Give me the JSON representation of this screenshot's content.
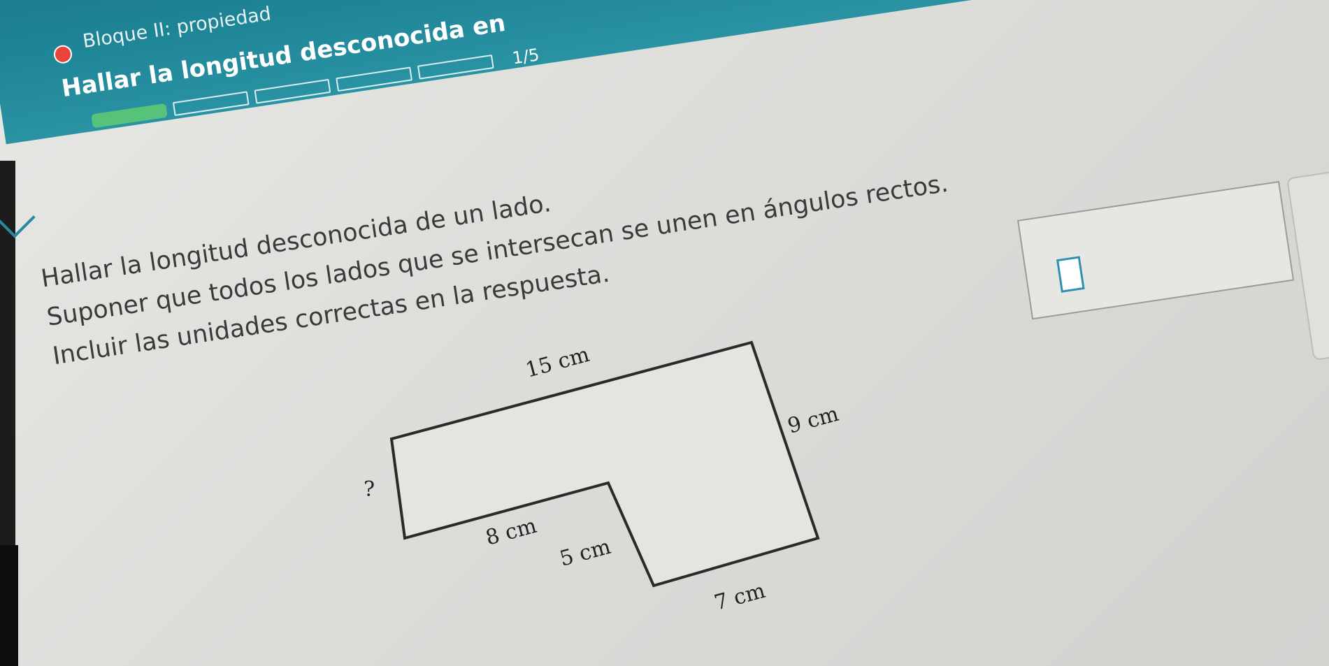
{
  "header": {
    "block_title": "Bloque II: propiedad",
    "topic_title": "Hallar la longitud desconocida en",
    "progress": {
      "current": 1,
      "total": 5,
      "label": "1/5"
    }
  },
  "problem": {
    "line1": "Hallar la longitud desconocida de un lado.",
    "line2": "Suponer que todos los lados que se intersecan se unen en ángulos rectos.",
    "line3": "Incluir las unidades correctas en la respuesta."
  },
  "figure": {
    "labels": {
      "top": "15 cm",
      "right": "9 cm",
      "unknown": "?",
      "inner_horizontal": "8 cm",
      "inner_vertical": "5 cm",
      "bottom": "7 cm"
    }
  },
  "answer": {
    "value": ""
  },
  "colors": {
    "header_teal": "#1d8496",
    "progress_green": "#56c27a",
    "record_red": "#e8443a",
    "input_border": "#2f8fb0"
  },
  "icons": {
    "record": "record-dot-icon",
    "collapse": "chevron-down-icon"
  }
}
